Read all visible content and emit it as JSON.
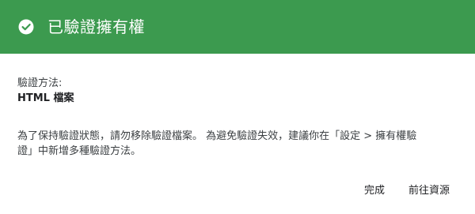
{
  "header": {
    "icon": "check-circle-icon",
    "title": "已驗證擁有權",
    "background": "#3c9a4f"
  },
  "verification": {
    "method_label": "驗證方法:",
    "method_value": "HTML 檔案"
  },
  "notice": {
    "line1": "為了保持驗證狀態，請勿移除驗證檔案。 為避免驗證失效，建議你在「設定 > 擁有權驗",
    "line2": "證」中新增多種驗證方法。"
  },
  "actions": {
    "done_label": "完成",
    "go_to_resource_label": "前往資源"
  }
}
